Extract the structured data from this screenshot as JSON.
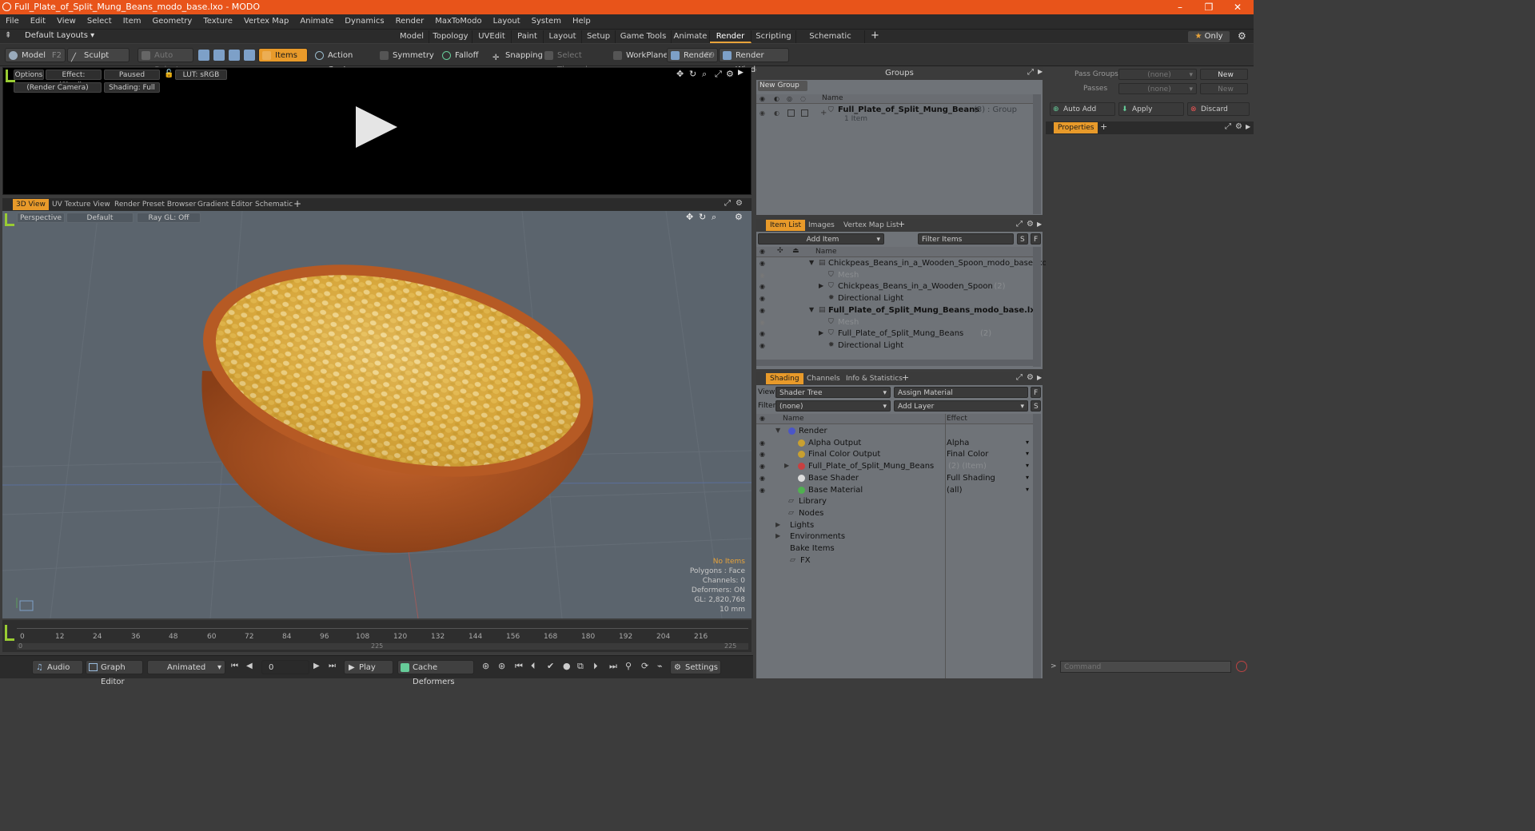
{
  "window": {
    "title": "Full_Plate_of_Split_Mung_Beans_modo_base.lxo - MODO",
    "controls": [
      "–",
      "❐",
      "✕"
    ]
  },
  "menu": [
    "File",
    "Edit",
    "View",
    "Select",
    "Item",
    "Geometry",
    "Texture",
    "Vertex Map",
    "Animate",
    "Dynamics",
    "Render",
    "MaxToModo",
    "Layout",
    "System",
    "Help"
  ],
  "layout": {
    "preset": "Default Layouts",
    "tabs": [
      "Model",
      "Topology",
      "UVEdit",
      "Paint",
      "Layout",
      "Setup",
      "Game Tools",
      "Animate",
      "Render",
      "Scripting",
      "Schematic Fusion"
    ],
    "active_tab": "Render",
    "only": "Only"
  },
  "toolbar": {
    "model": "Model",
    "model_key": "F2",
    "sculpt": "Sculpt",
    "auto_select": "Auto Select",
    "items": "Items",
    "action_center": "Action Center",
    "symmetry": "Symmetry",
    "falloff": "Falloff",
    "snapping": "Snapping",
    "select_through": "Select Through",
    "workplane": "WorkPlane",
    "render": "Render",
    "render_key": "F9",
    "render_window": "Render Window"
  },
  "render_view": {
    "options": "Options",
    "effect": "Effect: (Shadi...",
    "paused": "Paused",
    "lut": "LUT: sRGB",
    "camera": "(Render Camera)",
    "shading": "Shading: Full"
  },
  "view_tabs": [
    "3D View",
    "UV Texture View",
    "Render Preset Browser",
    "Gradient Editor",
    "Schematic"
  ],
  "viewport": {
    "perspective": "Perspective",
    "default": "Default",
    "raygl": "Ray GL: Off",
    "hud": [
      "No Items",
      "Polygons : Face",
      "Channels: 0",
      "Deformers: ON",
      "GL: 2,820,768",
      "10 mm"
    ]
  },
  "timeline": {
    "ticks": [
      "0",
      "12",
      "24",
      "36",
      "48",
      "60",
      "72",
      "84",
      "96",
      "108",
      "120",
      "132",
      "144",
      "156",
      "168",
      "180",
      "192",
      "204",
      "216"
    ],
    "sub_ticks": [
      "0",
      "225",
      "225"
    ]
  },
  "transport": {
    "audio": "Audio",
    "graph_editor": "Graph Editor",
    "animated": "Animated",
    "frame": "0",
    "play": "Play",
    "cache_deformers": "Cache Deformers",
    "settings": "Settings"
  },
  "groups": {
    "title": "Groups",
    "new_group": "New Group",
    "col_name": "Name",
    "row_name": "Full_Plate_of_Split_Mung_Beans",
    "row_count": "(3)",
    "row_type": ": Group",
    "row_sub": "1 Item"
  },
  "item_list": {
    "tabs": [
      "Item List",
      "Images",
      "Vertex Map List"
    ],
    "add_item": "Add Item",
    "filter_items": "Filter Items",
    "s": "S",
    "f": "F",
    "col_name": "Name",
    "rows": [
      {
        "label": "Chickpeas_Beans_in_a_Wooden_Spoon_modo_base.lxo",
        "count": "",
        "indent": 0,
        "bold": false,
        "gray": false
      },
      {
        "label": "Mesh",
        "count": "",
        "indent": 1,
        "bold": false,
        "gray": true
      },
      {
        "label": "Chickpeas_Beans_in_a_Wooden_Spoon",
        "count": "(2)",
        "indent": 1,
        "bold": false,
        "gray": false
      },
      {
        "label": "Directional Light",
        "count": "",
        "indent": 1,
        "bold": false,
        "gray": false
      },
      {
        "label": "Full_Plate_of_Split_Mung_Beans_modo_base.lxo",
        "count": "",
        "indent": 0,
        "bold": true,
        "gray": false
      },
      {
        "label": "Mesh",
        "count": "",
        "indent": 1,
        "bold": false,
        "gray": true
      },
      {
        "label": "Full_Plate_of_Split_Mung_Beans",
        "count": "(2)",
        "indent": 1,
        "bold": false,
        "gray": false
      },
      {
        "label": "Directional Light",
        "count": "",
        "indent": 1,
        "bold": false,
        "gray": false
      }
    ]
  },
  "shading": {
    "tabs": [
      "Shading",
      "Channels",
      "Info & Statistics"
    ],
    "view_label": "View",
    "view_value": "Shader Tree",
    "assign_material": "Assign Material",
    "filter_label": "Filter",
    "filter_value": "(none)",
    "add_layer": "Add Layer",
    "col_name": "Name",
    "col_effect": "Effect",
    "rows": [
      {
        "label": "Render",
        "extra": "",
        "effect": "",
        "indent": 0
      },
      {
        "label": "Alpha Output",
        "extra": "",
        "effect": "Alpha",
        "indent": 1
      },
      {
        "label": "Final Color Output",
        "extra": "",
        "effect": "Final Color",
        "indent": 1
      },
      {
        "label": "Full_Plate_of_Split_Mung_Beans",
        "extra": "(2) (Item)",
        "effect": "",
        "indent": 1
      },
      {
        "label": "Base Shader",
        "extra": "",
        "effect": "Full Shading",
        "indent": 1
      },
      {
        "label": "Base Material",
        "extra": "",
        "effect": "(all)",
        "indent": 1
      },
      {
        "label": "Library",
        "extra": "",
        "effect": "",
        "indent": 0
      },
      {
        "label": "Nodes",
        "extra": "",
        "effect": "",
        "indent": 0
      },
      {
        "label": "Lights",
        "extra": "",
        "effect": "",
        "indent": -1
      },
      {
        "label": "Environments",
        "extra": "",
        "effect": "",
        "indent": -1
      },
      {
        "label": "Bake Items",
        "extra": "",
        "effect": "",
        "indent": -1
      },
      {
        "label": "FX",
        "extra": "",
        "effect": "",
        "indent": -1
      }
    ]
  },
  "passes": {
    "pass_groups_label": "Pass Groups",
    "pass_groups_value": "(none)",
    "new": "New",
    "passes_label": "Passes",
    "passes_value": "(none)",
    "new2": "New",
    "auto_add": "Auto Add",
    "apply": "Apply",
    "discard": "Discard",
    "properties": "Properties"
  },
  "command": {
    "placeholder": "Command"
  },
  "colors": {
    "accent": "#e89a2a",
    "titlebar": "#e8541a"
  }
}
